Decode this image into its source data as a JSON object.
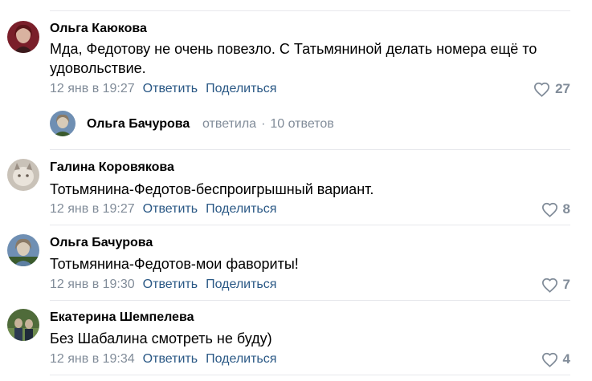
{
  "comments": [
    {
      "author": "Ольга Каюкова",
      "text": "Мда, Федотову не очень повезло. С Татьмяниной делать номера ещё то удовольствие.",
      "date": "12 янв в 19:27",
      "reply_label": "Ответить",
      "share_label": "Поделиться",
      "likes": "27",
      "avatar_colors": [
        "#7a1f2a",
        "#d9b2a0",
        "#3b1a1c"
      ]
    },
    {
      "author": "Галина Коровякова",
      "text": "Тотьмянина-Федотов-беспроигрышный вариант.",
      "date": "12 янв в 19:27",
      "reply_label": "Ответить",
      "share_label": "Поделиться",
      "likes": "8",
      "avatar_colors": [
        "#c9c2b8",
        "#e9e3da",
        "#9a8f84"
      ]
    },
    {
      "author": "Ольга Бачурова",
      "text": "Тотьмянина-Федотов-мои фавориты!",
      "date": "12 янв в 19:30",
      "reply_label": "Ответить",
      "share_label": "Поделиться",
      "likes": "7",
      "avatar_colors": [
        "#5d7fa3",
        "#d8cbb8",
        "#3a5a2c"
      ]
    },
    {
      "author": "Екатерина Шемпелева",
      "text": "Без Шабалина смотреть не буду)",
      "date": "12 янв в 19:34",
      "reply_label": "Ответить",
      "share_label": "Поделиться",
      "likes": "4",
      "avatar_colors": [
        "#4f6b3a",
        "#2d3a52",
        "#c7b39a"
      ]
    }
  ],
  "reply_thread": {
    "author": "Ольга Бачурова",
    "action": "ответила",
    "separator": "·",
    "count": "10 ответов"
  },
  "colors": {
    "link": "#2a5885",
    "muted": "#818c99",
    "divider": "#e7e8ec"
  },
  "icons": {
    "like": "heart-outline-icon"
  }
}
